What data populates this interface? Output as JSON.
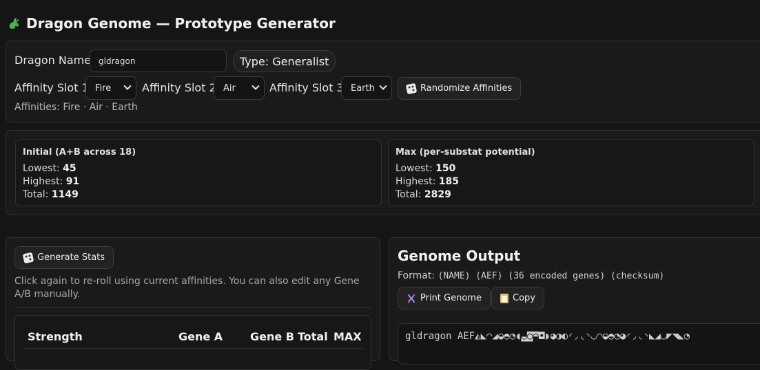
{
  "app": {
    "title": "Dragon Genome — Prototype Generator",
    "logo_icon": "dragon-icon"
  },
  "config": {
    "name_label": "Dragon Name",
    "name_value": "gldragon",
    "type_badge": "Type: Generalist",
    "slot1_label": "Affinity Slot 1",
    "slot1_value": "Fire",
    "slot2_label": "Affinity Slot 2",
    "slot2_value": "Air",
    "slot3_label": "Affinity Slot 3",
    "slot3_value": "Earth",
    "randomize_label": "Randomize Affinities",
    "affinities_summary": "Affinities: Fire · Air · Earth"
  },
  "summary": {
    "initial": {
      "title": "Initial (A+B across 18)",
      "lowest_label": "Lowest:",
      "lowest": "45",
      "highest_label": "Highest:",
      "highest": "91",
      "total_label": "Total:",
      "total": "1149"
    },
    "max": {
      "title": "Max (per-substat potential)",
      "lowest_label": "Lowest:",
      "lowest": "150",
      "highest_label": "Highest:",
      "highest": "185",
      "total_label": "Total:",
      "total": "2829"
    }
  },
  "stats": {
    "generate_label": "Generate Stats",
    "help_text": "Click again to re-roll using current affinities. You can also edit any Gene A/B manually.",
    "columns": [
      "Strength",
      "Gene A",
      "Gene B",
      "Total",
      "MAX"
    ]
  },
  "genome": {
    "title": "Genome Output",
    "format_label": "Format:",
    "format_value": "(NAME) (AEF) (36 encoded genes) (checksum)",
    "print_label": "Print Genome",
    "copy_label": "Copy",
    "output_text": "gldragon AEF◭◣◠◢◒◓◔◖◛◙◚◘◗◕◑◐◜◞◟◝◡◠◒◓◔◕◜◞◟◝◣◢◡◤◥◣◔"
  }
}
